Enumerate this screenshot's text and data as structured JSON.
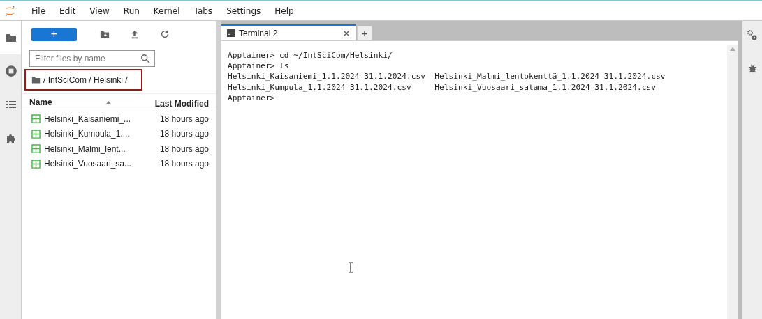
{
  "menu": [
    "File",
    "Edit",
    "View",
    "Run",
    "Kernel",
    "Tabs",
    "Settings",
    "Help"
  ],
  "left_sidebar": [
    {
      "kind": "folder",
      "selected": true
    },
    {
      "kind": "running",
      "selected": false
    },
    {
      "kind": "toc",
      "selected": false
    },
    {
      "kind": "extensions",
      "selected": false
    }
  ],
  "file_browser": {
    "new_button": "+",
    "filter": {
      "placeholder": "Filter files by name"
    },
    "breadcrumb": "/ IntSciCom / Helsinki /",
    "columns": [
      "Name",
      "Last Modified"
    ],
    "rows": [
      {
        "name": "Helsinki_Kaisaniemi_...",
        "modified": "18 hours ago"
      },
      {
        "name": "Helsinki_Kumpula_1....",
        "modified": "18 hours ago"
      },
      {
        "name": "Helsinki_Malmi_lent...",
        "modified": "18 hours ago"
      },
      {
        "name": "Helsinki_Vuosaari_sa...",
        "modified": "18 hours ago"
      }
    ]
  },
  "tabs": [
    {
      "label": "Terminal 2",
      "selected": true
    }
  ],
  "new_tab": "+",
  "terminal": [
    "Apptainer> cd ~/IntSciCom/Helsinki/",
    "Apptainer> ls",
    "Helsinki_Kaisaniemi_1.1.2024-31.1.2024.csv  Helsinki_Malmi_lentokenttä_1.1.2024-31.1.2024.csv",
    "Helsinki_Kumpula_1.1.2024-31.1.2024.csv     Helsinki_Vuosaari_satama_1.1.2024-31.1.2024.csv",
    "Apptainer>"
  ]
}
